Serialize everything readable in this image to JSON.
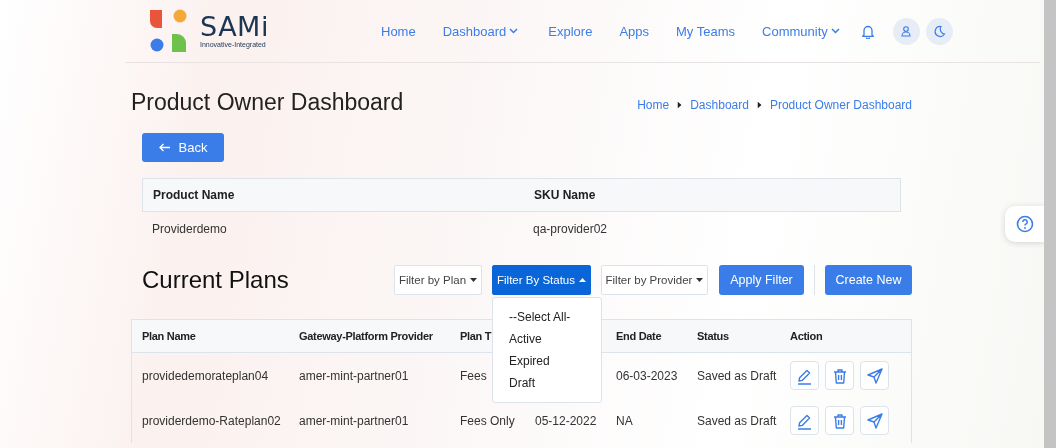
{
  "header": {
    "logo": {
      "name": "SAMi",
      "tagline": "Innovative-Integrated"
    },
    "nav": [
      {
        "label": "Home",
        "dropdown": false
      },
      {
        "label": "Dashboard",
        "dropdown": true
      },
      {
        "label": "Explore",
        "dropdown": false
      },
      {
        "label": "Apps",
        "dropdown": false
      },
      {
        "label": "My Teams",
        "dropdown": false
      },
      {
        "label": "Community",
        "dropdown": true
      }
    ]
  },
  "page": {
    "title": "Product Owner Dashboard",
    "breadcrumb": [
      "Home",
      "Dashboard",
      "Product Owner Dashboard"
    ],
    "back_button": "Back"
  },
  "product_table": {
    "columns": [
      "Product Name",
      "SKU Name"
    ],
    "rows": [
      [
        "Providerdemo",
        "qa-provider02"
      ]
    ]
  },
  "plans": {
    "title": "Current Plans",
    "filters": [
      {
        "label": "Filter by Plan",
        "open": false
      },
      {
        "label": "Filter By Status",
        "open": true
      },
      {
        "label": "Filter by Provider",
        "open": false
      }
    ],
    "buttons": [
      "Apply Filter",
      "Create New"
    ],
    "status_menu": [
      "--Select All-",
      "Active",
      "Expired",
      "Draft"
    ],
    "table": {
      "columns": {
        "plan_name": "Plan Name",
        "provider": "Gateway-Platform Provider",
        "plan_type": "Plan T",
        "end_date": "End Date",
        "status": "Status",
        "action": "Action"
      },
      "rows": [
        {
          "plan_name": "providedemorateplan04",
          "provider": "amer-mint-partner01",
          "plan_type": "Fees",
          "end_date": "06-03-2023",
          "status": "Saved as Draft"
        },
        {
          "plan_name": "providerdemo-Rateplan02",
          "provider": "amer-mint-partner01",
          "plan_type": "Fees Only",
          "start_date": "05-12-2022",
          "end_date": "NA",
          "status": "Saved as Draft"
        }
      ]
    }
  }
}
